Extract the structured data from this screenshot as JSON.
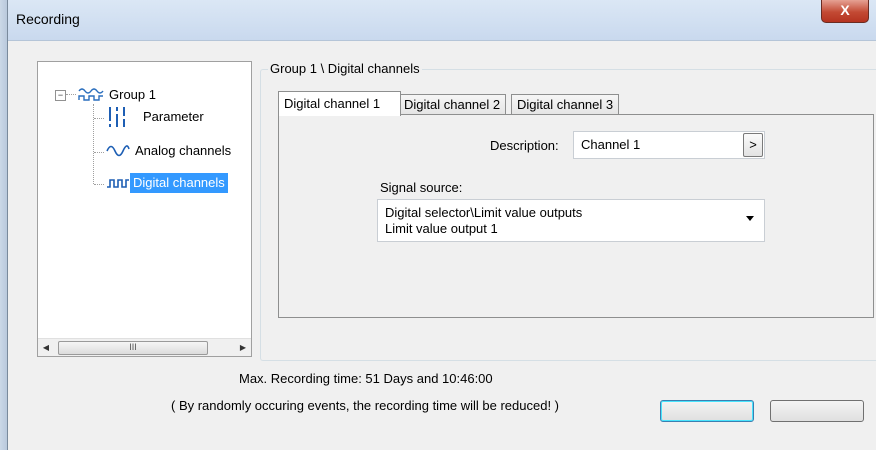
{
  "window": {
    "title": "Recording",
    "close_glyph": "X"
  },
  "tree": {
    "root": {
      "label": "Group 1",
      "icon": "wave-group-icon",
      "expander": "−"
    },
    "items": [
      {
        "label": "Parameter",
        "icon": "parameter-icon",
        "selected": false
      },
      {
        "label": "Analog channels",
        "icon": "analog-wave-icon",
        "selected": false
      },
      {
        "label": "Digital channels",
        "icon": "digital-wave-icon",
        "selected": true
      }
    ],
    "scrollbar": {
      "thumb_grip": "III"
    }
  },
  "group_box": {
    "title": "Group 1 \\ Digital channels"
  },
  "tabs": [
    {
      "label": "Digital channel 1",
      "active": true
    },
    {
      "label": "Digital channel 2",
      "active": false
    },
    {
      "label": "Digital channel 3",
      "active": false
    }
  ],
  "form": {
    "description_label": "Description:",
    "description_value": "Channel 1",
    "description_button": ">",
    "signal_source_label": "Signal source:",
    "signal_source_line1": "Digital selector\\Limit value outputs",
    "signal_source_line2": "Limit value output 1"
  },
  "info": {
    "max_time": "Max. Recording time: 51 Days and 10:46:00",
    "note": "( By randomly occuring events, the recording time will be reduced! )"
  },
  "colors": {
    "selection": "#3399ff",
    "close_button": "#c34a34"
  }
}
